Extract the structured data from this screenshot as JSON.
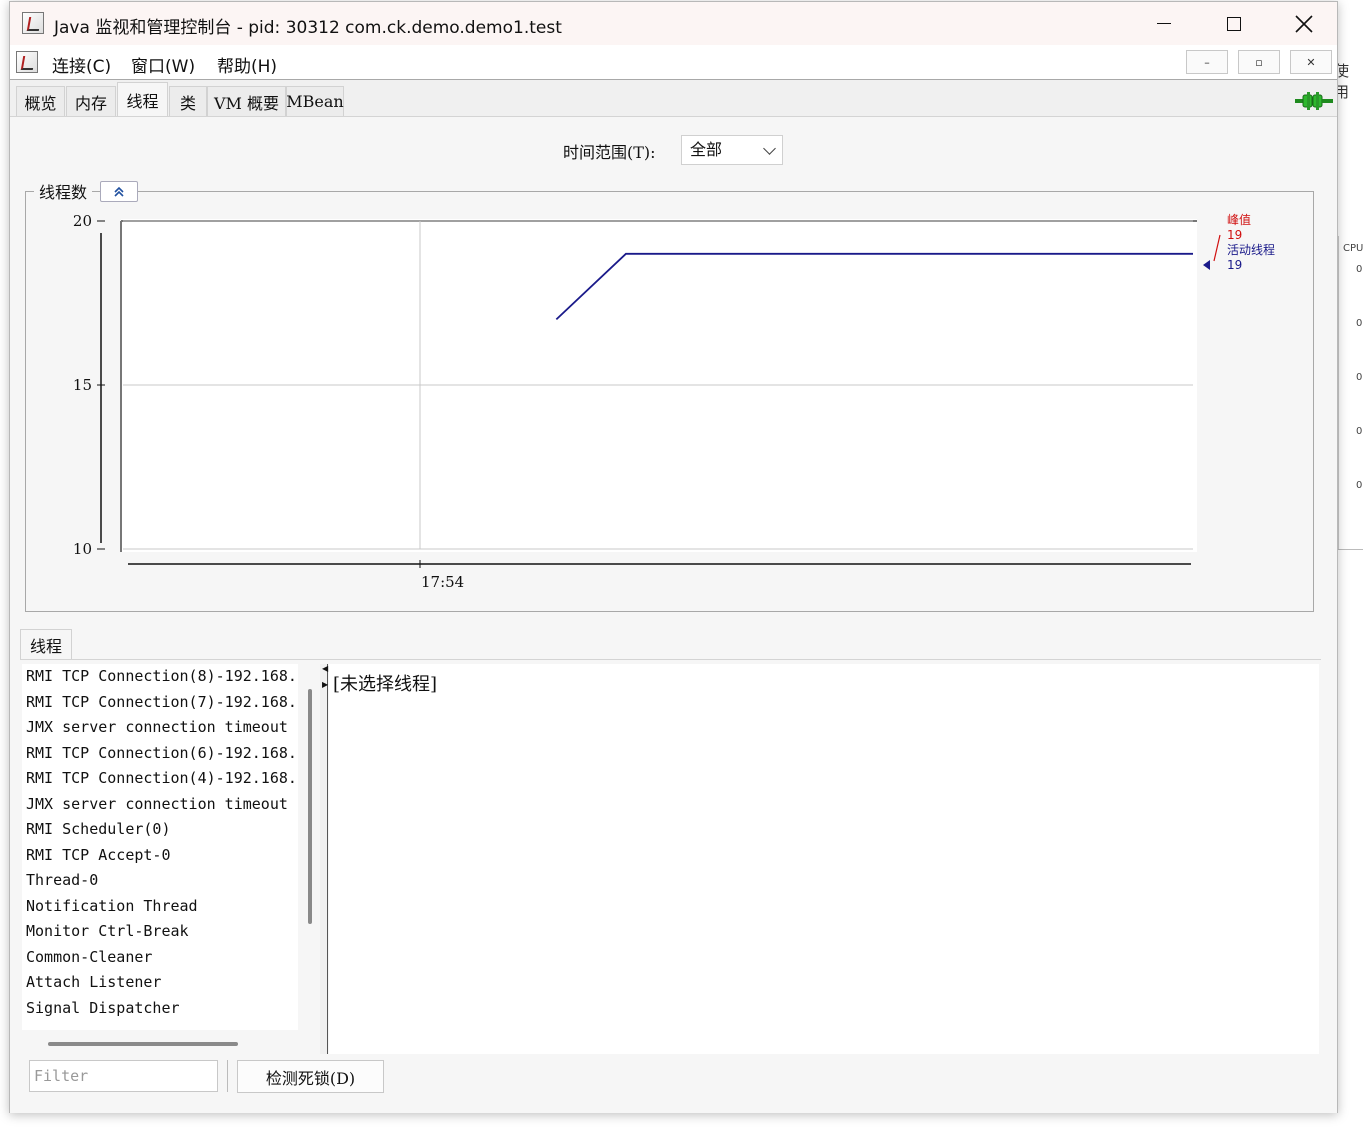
{
  "window": {
    "title": "Java 监视和管理控制台 - pid: 30312 com.ck.demo.demo1.test"
  },
  "menu": {
    "items": [
      "连接(C)",
      "窗口(W)",
      "帮助(H)"
    ],
    "inner_controls": [
      "–",
      "▫",
      "✕"
    ]
  },
  "tabs": [
    "概览",
    "内存",
    "线程",
    "类",
    "VM 概要",
    "MBean"
  ],
  "active_tab": "线程",
  "time_range": {
    "label": "时间范围(T):",
    "value": "全部"
  },
  "chart_panel": {
    "title": "线程数"
  },
  "chart_data": {
    "type": "line",
    "title": "",
    "xlabel": "",
    "ylabel": "",
    "ylim": [
      10,
      20
    ],
    "yticks": [
      10,
      15,
      20
    ],
    "xticks": [
      "17:54"
    ],
    "grid": true,
    "legend_position": "right",
    "series": [
      {
        "name": "活动线程",
        "color": "#1a1a8a",
        "points": [
          {
            "t": 0.405,
            "v": 17
          },
          {
            "t": 0.47,
            "v": 19
          },
          {
            "t": 1.0,
            "v": 19
          }
        ]
      }
    ],
    "legend": [
      {
        "label": "峰值",
        "value": "19",
        "color": "#d01010"
      },
      {
        "label": "活动线程",
        "value": "19",
        "color": "#1a1a8a"
      }
    ]
  },
  "threads": {
    "tab_label": "线程",
    "list": [
      "RMI TCP Connection(8)-192.168.",
      "RMI TCP Connection(7)-192.168.",
      "JMX server connection timeout",
      "RMI TCP Connection(6)-192.168.",
      "RMI TCP Connection(4)-192.168.",
      "JMX server connection timeout",
      "RMI Scheduler(0)",
      "RMI TCP Accept-0",
      "Thread-0",
      "Notification Thread",
      "Monitor Ctrl-Break",
      "Common-Cleaner",
      "Attach Listener",
      "Signal Dispatcher"
    ],
    "detail": "[未选择线程]",
    "filter_placeholder": "Filter",
    "deadlock_button": "检测死锁(D)"
  },
  "background": {
    "right_text": "使用",
    "cpu_label": "CPU",
    "zeros": [
      "0",
      "0",
      "0",
      "0",
      "0"
    ]
  }
}
